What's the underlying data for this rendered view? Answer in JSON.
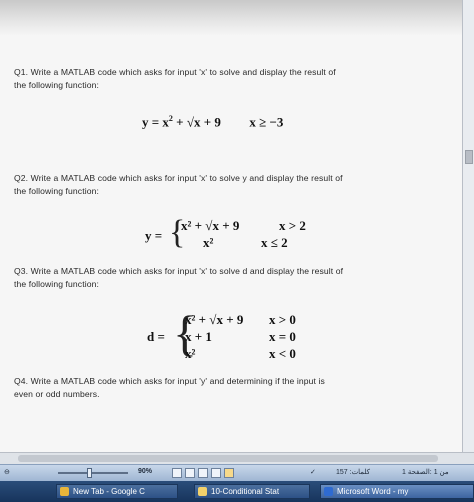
{
  "questions": {
    "q1_line1": "Q1. Write a MATLAB code which asks for input 'x' to solve and display the result of",
    "q1_line2": "the following function:",
    "q2_line1": "Q2. Write a MATLAB code which asks for input 'x' to solve y and display the result of",
    "q2_line2": "the following function:",
    "q3_line1": "Q3. Write a MATLAB code which asks for input 'x' to solve d and display the result of",
    "q3_line2": "the following function:",
    "q4_line1": "Q4. Write a MATLAB code which asks for input 'y' and determining if the input is",
    "q4_line2": "even or odd numbers."
  },
  "eq1": {
    "lhs": "y = x",
    "rhs": " + √x + 9",
    "cond": "x ≥ −3"
  },
  "eq2": {
    "lhs": "y =",
    "case1": "x² + √x + 9",
    "cond1": "x > 2",
    "case2": "x²",
    "cond2": "x ≤ 2"
  },
  "eq3": {
    "lhs": "d =",
    "case1": "x² + √x + 9",
    "cond1": "x > 0",
    "case2": "x + 1",
    "cond2": "x = 0",
    "case3": "x²",
    "cond3": "x < 0"
  },
  "status_bar": {
    "zoom": "90%",
    "words": "157 :كلمات",
    "page": "1 من 1 :الصفحة"
  },
  "taskbar": {
    "items": [
      "New Tab - Google C",
      "10-Conditional Stat",
      "Microsoft Word - my"
    ]
  }
}
